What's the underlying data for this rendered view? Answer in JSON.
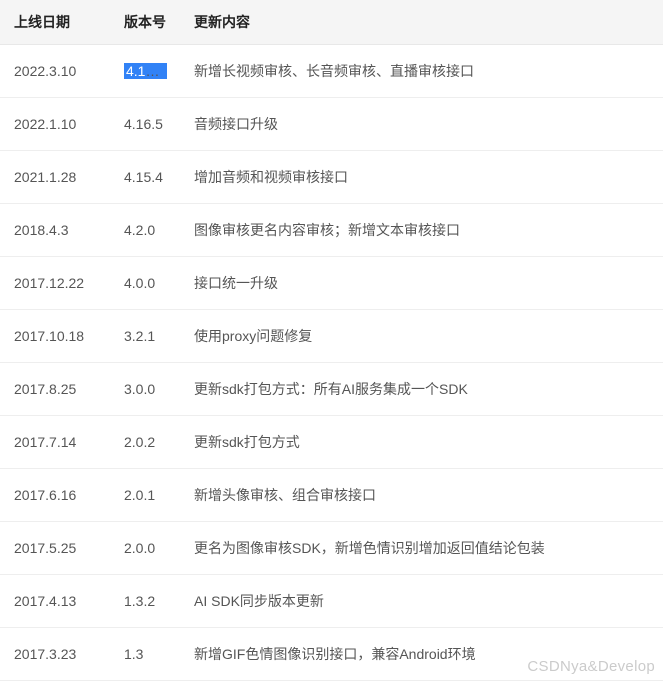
{
  "table": {
    "headers": {
      "date": "上线日期",
      "version": "版本号",
      "content": "更新内容"
    },
    "rows": [
      {
        "date": "2022.3.10",
        "version": "4.16.6",
        "content": "新增长视频审核、长音频审核、直播审核接口",
        "version_highlight": true
      },
      {
        "date": "2022.1.10",
        "version": "4.16.5",
        "content": "音频接口升级"
      },
      {
        "date": "2021.1.28",
        "version": "4.15.4",
        "content": "增加音频和视频审核接口"
      },
      {
        "date": "2018.4.3",
        "version": "4.2.0",
        "content": "图像审核更名内容审核；新增文本审核接口"
      },
      {
        "date": "2017.12.22",
        "version": "4.0.0",
        "content": "接口统一升级"
      },
      {
        "date": "2017.10.18",
        "version": "3.2.1",
        "content": "使用proxy问题修复"
      },
      {
        "date": "2017.8.25",
        "version": "3.0.0",
        "content": "更新sdk打包方式：所有AI服务集成一个SDK"
      },
      {
        "date": "2017.7.14",
        "version": "2.0.2",
        "content": "更新sdk打包方式"
      },
      {
        "date": "2017.6.16",
        "version": "2.0.1",
        "content": "新增头像审核、组合审核接口"
      },
      {
        "date": "2017.5.25",
        "version": "2.0.0",
        "content": "更名为图像审核SDK，新增色情识别增加返回值结论包装"
      },
      {
        "date": "2017.4.13",
        "version": "1.3.2",
        "content": "AI SDK同步版本更新"
      },
      {
        "date": "2017.3.23",
        "version": "1.3",
        "content": "新增GIF色情图像识别接口，兼容Android环境"
      }
    ]
  },
  "watermark": "CSDNya&Develop"
}
